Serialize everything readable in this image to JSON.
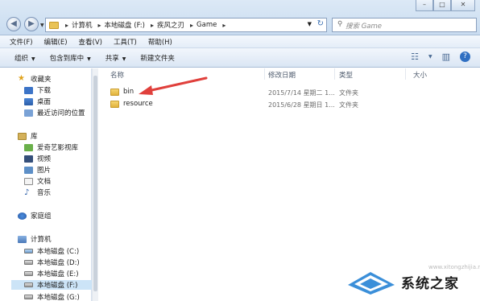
{
  "window": {
    "buttons": [
      "–",
      "□",
      "✕"
    ]
  },
  "address": {
    "crumbs": [
      "计算机",
      "本地磁盘 (F:)",
      "疾风之刃",
      "Game"
    ],
    "search_placeholder": "搜索 Game"
  },
  "menu": [
    "文件(F)",
    "编辑(E)",
    "查看(V)",
    "工具(T)",
    "帮助(H)"
  ],
  "toolbar": {
    "organize": "组织",
    "include_library": "包含到库中",
    "share": "共享",
    "new_folder": "新建文件夹"
  },
  "sidebar": {
    "favorites": "收藏夹",
    "downloads": "下载",
    "desktop": "桌面",
    "recent": "最近访问的位置",
    "libraries": "库",
    "iqiyi": "爱奇艺影视库",
    "videos": "视频",
    "pictures": "图片",
    "documents": "文档",
    "music": "音乐",
    "homegroup": "家庭组",
    "computer": "计算机",
    "drive_c": "本地磁盘 (C:)",
    "drive_d": "本地磁盘 (D:)",
    "drive_e": "本地磁盘 (E:)",
    "drive_f": "本地磁盘 (F:)",
    "drive_g": "本地磁盘 (G:)"
  },
  "columns": {
    "name": "名称",
    "modified": "修改日期",
    "type": "类型",
    "size": "大小"
  },
  "files": [
    {
      "name": "bin",
      "modified": "2015/7/14 星期二 1...",
      "type": "文件夹"
    },
    {
      "name": "resource",
      "modified": "2015/6/28 星期日 1...",
      "type": "文件夹"
    }
  ],
  "watermark": {
    "text": "系统之家",
    "url": "www.xitongzhijia.net"
  },
  "colors": {
    "accent": "#3c74c7",
    "arrow": "#e0403c",
    "selection": "#cce4f7"
  }
}
